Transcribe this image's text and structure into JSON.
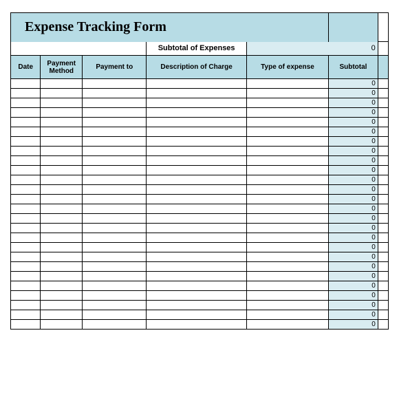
{
  "title": "Expense Tracking Form",
  "subtotal_label": "Subtotal of Expenses",
  "subtotal_value": "0",
  "headers": {
    "date": "Date",
    "method": "Payment Method",
    "payto": "Payment to",
    "desc": "Description of  Charge",
    "type": "Type of expense",
    "sub": "Subtotal"
  },
  "row_subtotal": "0",
  "row_count": 26
}
